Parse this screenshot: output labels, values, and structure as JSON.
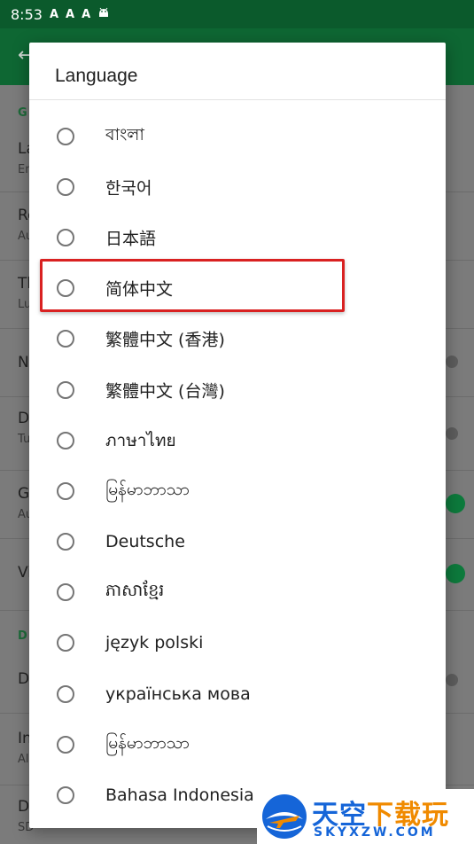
{
  "status_bar": {
    "time": "8:53",
    "icons": [
      "A",
      "A",
      "A",
      "android-icon"
    ]
  },
  "background": {
    "section_1": "G",
    "items": [
      {
        "title": "La",
        "subtitle": "En"
      },
      {
        "title": "Re",
        "subtitle": "Au"
      },
      {
        "title": "Th",
        "subtitle": "Lu"
      },
      {
        "title": "N",
        "subtitle": ""
      },
      {
        "title": "D",
        "subtitle": "Tu"
      },
      {
        "title": "G",
        "subtitle": "Au"
      },
      {
        "title": "Vi",
        "subtitle": ""
      }
    ],
    "section_2": "D",
    "items_2": [
      {
        "title": "De",
        "subtitle": ""
      },
      {
        "title": "In",
        "subtitle": "Al"
      },
      {
        "title": "Do",
        "subtitle": "SD"
      }
    ]
  },
  "dialog": {
    "title": "Language",
    "options": [
      {
        "label": "বাংলা"
      },
      {
        "label": "한국어"
      },
      {
        "label": "日本語"
      },
      {
        "label": "简体中文"
      },
      {
        "label": "繁體中文 (香港)"
      },
      {
        "label": "繁體中文 (台灣)"
      },
      {
        "label": "ภาษาไทย"
      },
      {
        "label": "မြန်မာဘာသာ"
      },
      {
        "label": "Deutsche"
      },
      {
        "label": "ភាសាខ្មែរ"
      },
      {
        "label": "język polski"
      },
      {
        "label": "українська мова"
      },
      {
        "label": "မြန်မာဘာသာ"
      },
      {
        "label": "Bahasa Indonesia"
      }
    ],
    "highlighted_option": "简体中文"
  },
  "watermark": {
    "cn_text_1": "天空",
    "cn_text_2": "下载玩",
    "en_text": "SKYXZW.COM"
  },
  "colors": {
    "status_bar": "#0b5a2c",
    "app_bar": "#0e6733",
    "highlight": "#d92121",
    "radio": "#757575"
  }
}
